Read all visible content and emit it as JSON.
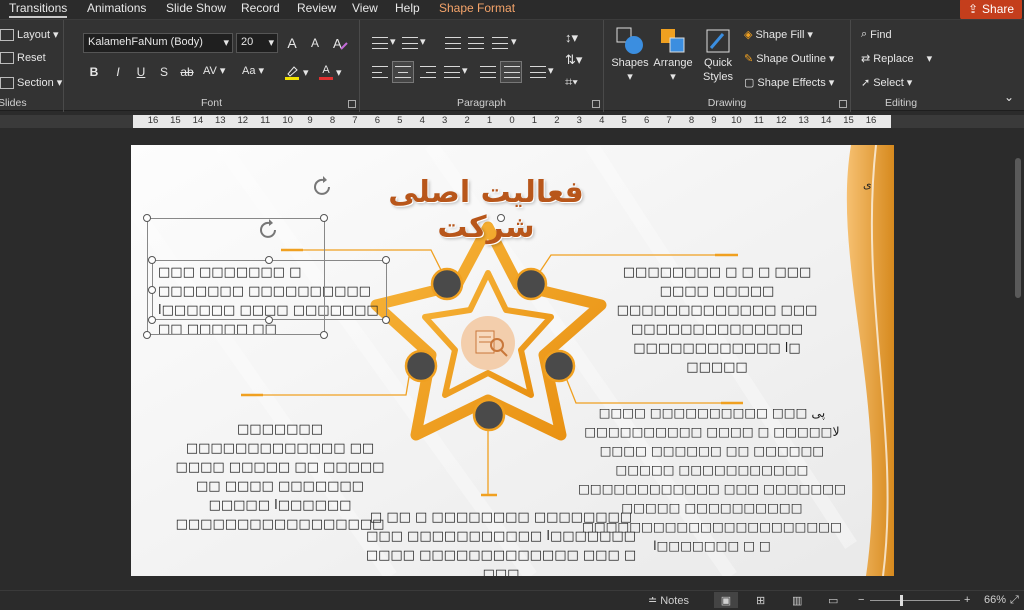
{
  "menu": {
    "tabs": [
      "Transitions",
      "Animations",
      "Slide Show",
      "Record",
      "Review",
      "View",
      "Help",
      "Shape Format"
    ],
    "active_tab": "Transitions",
    "share_label": "Share"
  },
  "ribbon": {
    "slides": {
      "label": "Slides",
      "layout": "Layout",
      "reset": "Reset",
      "section": "Section"
    },
    "font": {
      "label": "Font",
      "family": "KalamehFaNum (Body)",
      "size": "20",
      "grow": "A",
      "shrink": "A",
      "bold": "B",
      "italic": "I",
      "underline": "U",
      "shadow": "S",
      "strike": "ab",
      "spacing": "AV",
      "case": "Aa",
      "highlight_color": "#f2e200",
      "font_color": "#e03030",
      "font_color_glyph": "A"
    },
    "paragraph": {
      "label": "Paragraph"
    },
    "drawing": {
      "label": "Drawing",
      "shapes": "Shapes",
      "arrange": "Arrange",
      "quick_styles_1": "Quick",
      "quick_styles_2": "Styles",
      "shape_fill": "Shape Fill",
      "shape_outline": "Shape Outline",
      "shape_effects": "Shape Effects"
    },
    "editing": {
      "label": "Editing",
      "find": "Find",
      "replace": "Replace",
      "select": "Select"
    }
  },
  "ruler": {
    "ticks": [
      "16",
      "15",
      "14",
      "13",
      "12",
      "11",
      "10",
      "9",
      "8",
      "7",
      "6",
      "5",
      "4",
      "3",
      "2",
      "1",
      "0",
      "1",
      "2",
      "3",
      "4",
      "5",
      "6",
      "7",
      "8",
      "9",
      "10",
      "11",
      "12",
      "13",
      "14",
      "15",
      "16"
    ]
  },
  "slide": {
    "title": "فعالیت اصلی شرکت",
    "corner_mark": "ی",
    "accent": "#f0a020",
    "accent_dark": "#e8830c",
    "node_fill": "#4a4a4a",
    "text_top_left": "□□□ □□□□□□□ □ □□□□□□□ □□□□□□□□□□ ا□□□□□□ □□□□ □□□□□□□ □□ □□□□□ □□",
    "text_top_right": "□□□□□□□□ □ □ □ □□□ □□□□ □□□□□ □□□□□□□□□□□□□ □□□ □□□□□□□□□□□□□□ □□□□□□□□□□□□ ا□ □□□□□",
    "text_mid_left": "□□□□□□□ □□□□□□□□□□□□□ □□ □□□□ □□□□□ □□ □□□□□ □□ □□□□ □□□□□□□ □□□□□ ا□□□□□□ □□□□□□□□□□□□□□□□□",
    "text_mid_right": "□□□□ □□□□□□□□□پی □□□ □ لا□□□□□ □ □□□□ □□□□□□□□□□ □□□□□□ □□ □□□□□□ □□□□ □□□□□□□□□□□ □□□□□ □□□□□□□ □□□ □□□□□□□□□□□□ □□□□□□□□□□ □□□□□ □□□□□□□□□□□□□□□□□□□□□□ ا□□□□□□□ □ □",
    "text_bottom": "□ □□ □ □□□□□□□□ □□□□□□□□ □□□ □□□□□□□□□□□ ا□□□□□□□ □□□□ □□□□□□□□□□□□□ □□□ □ □□□"
  },
  "status": {
    "notes": "Notes",
    "zoom": "66%",
    "zoom_level": 0.66
  }
}
